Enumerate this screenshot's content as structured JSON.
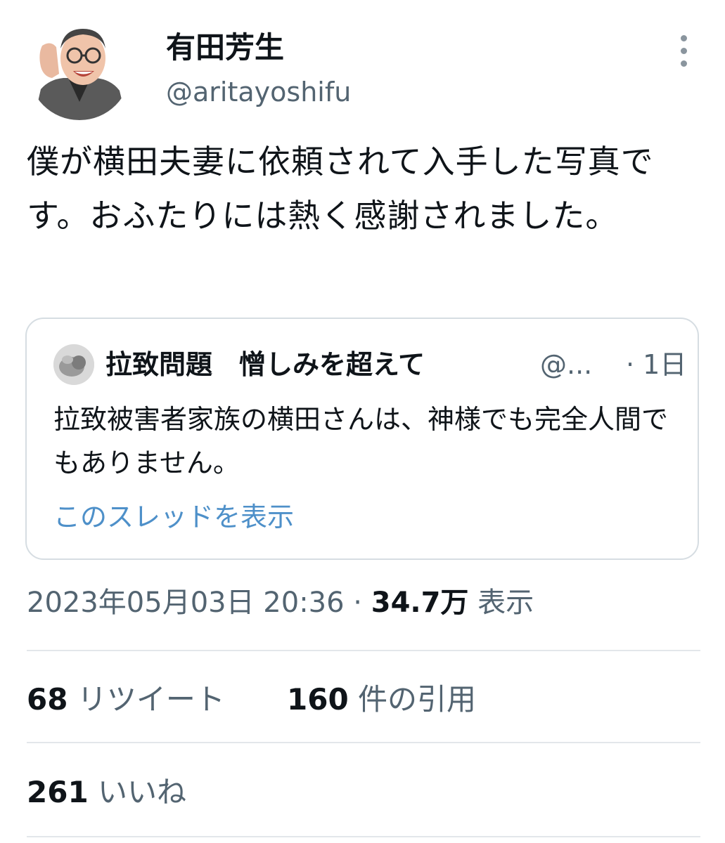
{
  "author": {
    "display_name": "有田芳生",
    "handle": "@aritayoshifu"
  },
  "tweet": {
    "text": "僕が横田夫妻に依頼されて入手した写真です。おふたりには熱く感謝されました。"
  },
  "quote": {
    "display_name": "拉致問題　憎しみを超えて",
    "handle": "@...",
    "time": "· 1日",
    "text": "拉致被害者家族の横田さんは、神様でも完全人間でもありません。",
    "show_thread": "このスレッドを表示"
  },
  "meta": {
    "datetime": "2023年05月03日 20:36 ·",
    "views_count": "34.7万",
    "views_label": "表示"
  },
  "stats": {
    "retweets_count": "68",
    "retweets_label": "リツイート",
    "quotes_count": "160",
    "quotes_label": "件の引用",
    "likes_count": "261",
    "likes_label": "いいね"
  },
  "icons": [
    "more-options-icon",
    "author-avatar",
    "quote-avatar"
  ],
  "colors": {
    "text": "#0f1419",
    "secondary": "#536471",
    "link": "#4e90c9",
    "border": "#d6dde2"
  }
}
